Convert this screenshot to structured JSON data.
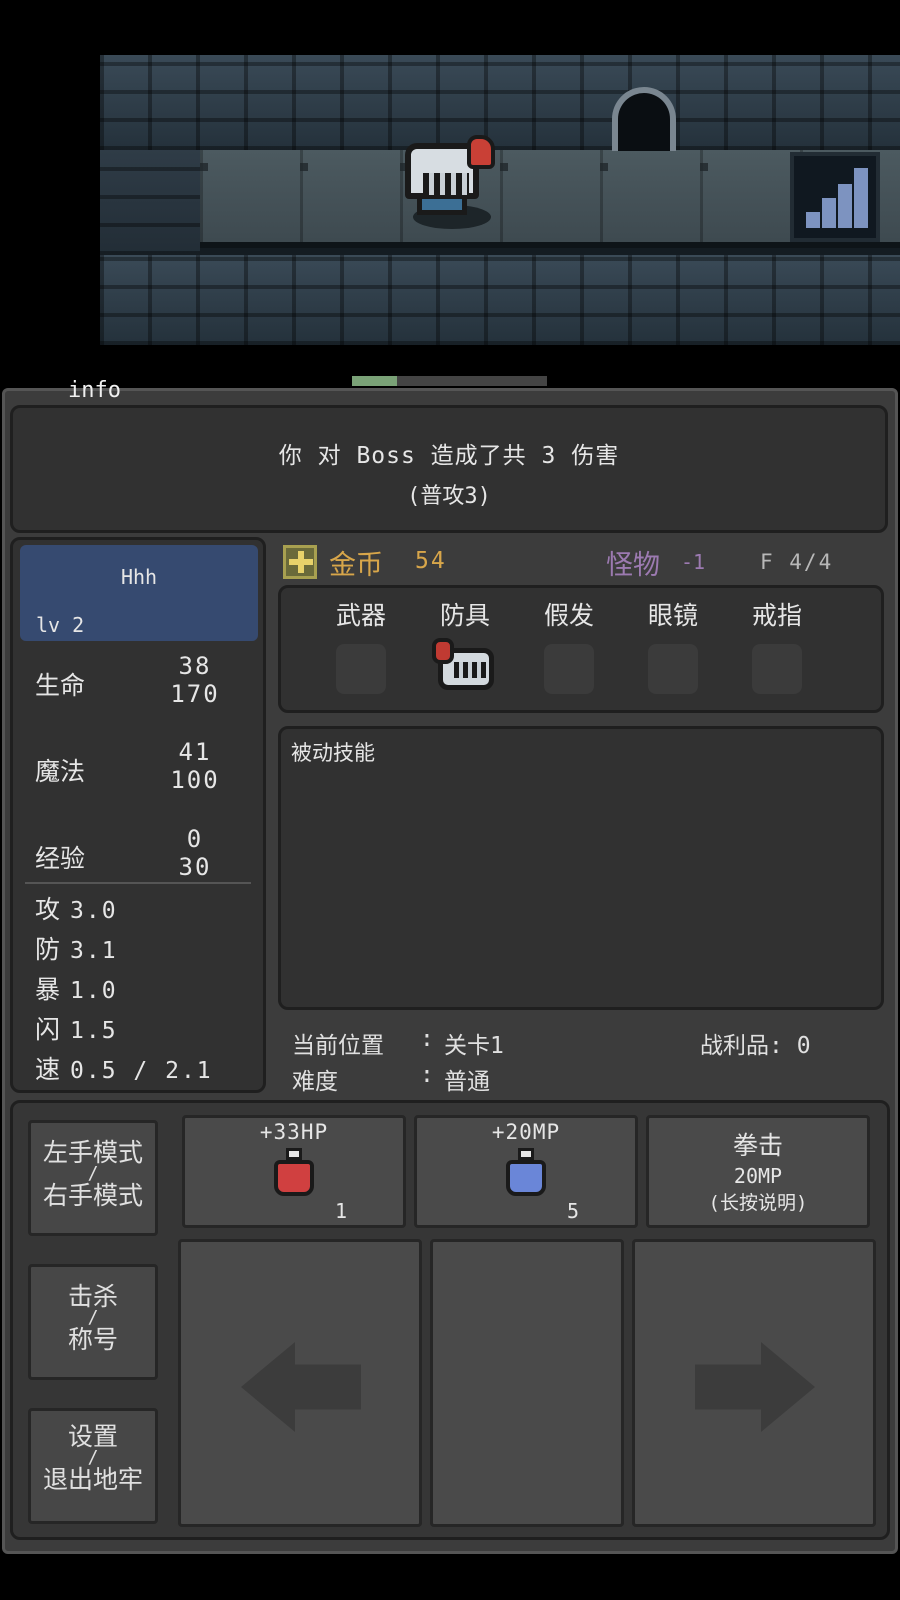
{
  "tab_label": "info",
  "message": {
    "line1": "你 对 Boss 造成了共 3 伤害",
    "line2": "(普攻3)"
  },
  "progress": {
    "fraction": 0.23,
    "fill_color": "#7aa277"
  },
  "player": {
    "name": "Hhh",
    "level": "lv 2",
    "hp": {
      "label": "生命",
      "current": "38",
      "max": "170"
    },
    "mp": {
      "label": "魔法",
      "current": "41",
      "max": "100"
    },
    "exp": {
      "label": "经验",
      "current": "0",
      "max": "30"
    },
    "attrs": [
      {
        "key": "攻",
        "value": "3.0"
      },
      {
        "key": "防",
        "value": "3.1"
      },
      {
        "key": "暴",
        "value": "1.0"
      },
      {
        "key": "闪",
        "value": "1.5"
      },
      {
        "key": "速",
        "value": "0.5 / 2.1"
      }
    ]
  },
  "gold": {
    "icon": "gold-plus-icon",
    "label": "金币",
    "value": "54",
    "color": "#d8a64a"
  },
  "monster": {
    "label": "怪物",
    "value": "-1",
    "color": "#9c7ab1"
  },
  "floor": "F 4/4",
  "equipment": {
    "slots": [
      "武器",
      "防具",
      "假发",
      "眼镜",
      "戒指"
    ],
    "equipped_icon": "knight-helmet-icon"
  },
  "passive": {
    "title": "被动技能"
  },
  "location": {
    "pos_label": "当前位置",
    "pos_sep": ":",
    "pos_value": "关卡1",
    "diff_label": "难度",
    "diff_sep": ":",
    "diff_value": "普通",
    "loot": "战利品: 0"
  },
  "side_buttons": {
    "hand": {
      "top": "左手模式",
      "mid": "/",
      "bottom": "右手模式"
    },
    "title": {
      "top": "击杀",
      "mid": "/",
      "bottom": "称号"
    },
    "settings": {
      "top": "设置",
      "mid": "/",
      "bottom": "退出地牢"
    }
  },
  "items": {
    "hp_potion": {
      "label": "+33HP",
      "count": "1",
      "color": "#d04040"
    },
    "mp_potion": {
      "label": "+20MP",
      "count": "5",
      "color": "#6a86d8"
    },
    "skill": {
      "name": "拳击",
      "cost": "20MP",
      "hint": "(长按说明)"
    }
  },
  "directions": {
    "left_icon": "arrow-left-icon",
    "right_icon": "arrow-right-icon"
  }
}
